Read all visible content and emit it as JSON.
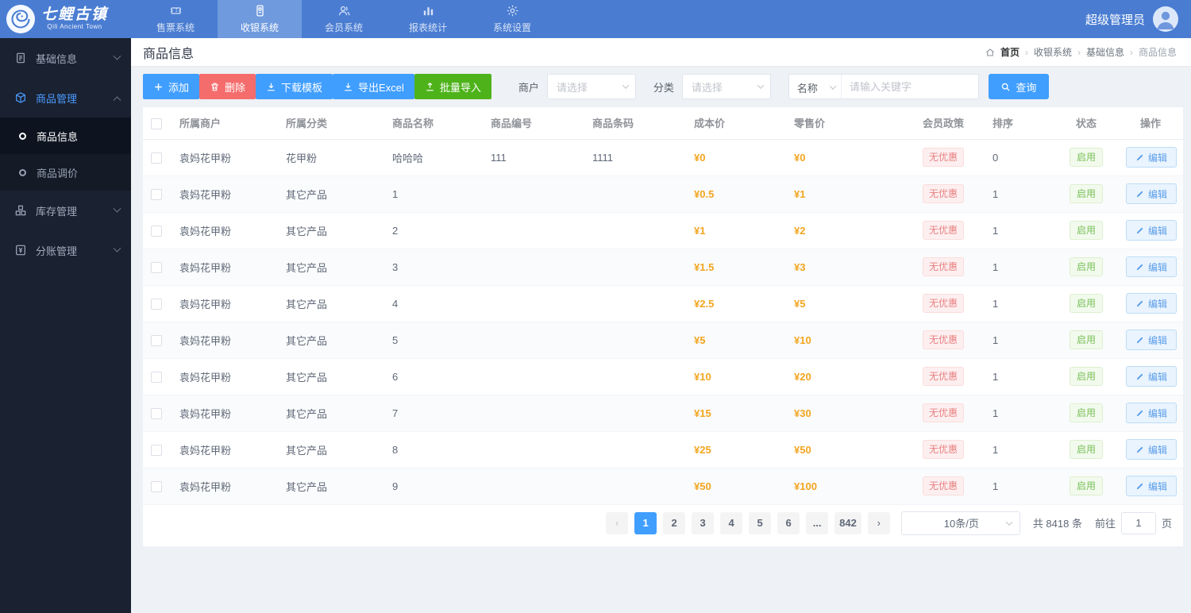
{
  "colors": {
    "topbar": "#4a7dd2",
    "accent": "#409eff",
    "danger": "#f56c6c",
    "success": "#4eb31b",
    "price": "#f2a51f"
  },
  "topbar": {
    "logo_title": "七鲤古镇",
    "logo_subtitle": "Qili Ancient Town",
    "nav": [
      {
        "label": "售票系统",
        "icon": "ticket-icon",
        "active": false
      },
      {
        "label": "收银系统",
        "icon": "pos-icon",
        "active": true
      },
      {
        "label": "会员系统",
        "icon": "members-icon",
        "active": false
      },
      {
        "label": "报表统计",
        "icon": "chart-icon",
        "active": false
      },
      {
        "label": "系统设置",
        "icon": "gear-icon",
        "active": false
      }
    ],
    "user": "超级管理员"
  },
  "sidebar": {
    "items": [
      {
        "label": "基础信息",
        "icon": "document-icon",
        "chevron": "down",
        "expanded": false,
        "children": []
      },
      {
        "label": "商品管理",
        "icon": "cube-icon",
        "chevron": "up",
        "expanded": true,
        "children": [
          {
            "label": "商品信息",
            "active": true
          },
          {
            "label": "商品调价",
            "active": false
          }
        ]
      },
      {
        "label": "库存管理",
        "icon": "inventory-icon",
        "chevron": "down",
        "expanded": false,
        "children": []
      },
      {
        "label": "分账管理",
        "icon": "ledger-icon",
        "chevron": "down",
        "expanded": false,
        "children": []
      }
    ]
  },
  "page": {
    "title": "商品信息",
    "breadcrumb": [
      "首页",
      "收银系统",
      "基础信息",
      "商品信息"
    ]
  },
  "toolbar": {
    "add_label": "添加",
    "delete_label": "删除",
    "download_template_label": "下载模板",
    "export_excel_label": "导出Excel",
    "batch_import_label": "批量导入",
    "merchant_label": "商户",
    "merchant_placeholder": "请选择",
    "category_label": "分类",
    "category_placeholder": "请选择",
    "name_field_label": "名称",
    "keyword_placeholder": "请输入关键字",
    "search_label": "查询"
  },
  "table": {
    "columns": [
      "所属商户",
      "所属分类",
      "商品名称",
      "商品编号",
      "商品条码",
      "成本价",
      "零售价",
      "会员政策",
      "排序",
      "状态",
      "操作"
    ],
    "edit_label": "编辑",
    "rows": [
      {
        "merchant": "袁妈花甲粉",
        "category": "花甲粉",
        "name": "哈哈哈",
        "code": "111",
        "barcode": "1111",
        "cost": "¥0",
        "price": "¥0",
        "policy": "无优惠",
        "sort": "0",
        "status": "启用"
      },
      {
        "merchant": "袁妈花甲粉",
        "category": "其它产品",
        "name": "1",
        "code": "",
        "barcode": "",
        "cost": "¥0.5",
        "price": "¥1",
        "policy": "无优惠",
        "sort": "1",
        "status": "启用"
      },
      {
        "merchant": "袁妈花甲粉",
        "category": "其它产品",
        "name": "2",
        "code": "",
        "barcode": "",
        "cost": "¥1",
        "price": "¥2",
        "policy": "无优惠",
        "sort": "1",
        "status": "启用"
      },
      {
        "merchant": "袁妈花甲粉",
        "category": "其它产品",
        "name": "3",
        "code": "",
        "barcode": "",
        "cost": "¥1.5",
        "price": "¥3",
        "policy": "无优惠",
        "sort": "1",
        "status": "启用"
      },
      {
        "merchant": "袁妈花甲粉",
        "category": "其它产品",
        "name": "4",
        "code": "",
        "barcode": "",
        "cost": "¥2.5",
        "price": "¥5",
        "policy": "无优惠",
        "sort": "1",
        "status": "启用"
      },
      {
        "merchant": "袁妈花甲粉",
        "category": "其它产品",
        "name": "5",
        "code": "",
        "barcode": "",
        "cost": "¥5",
        "price": "¥10",
        "policy": "无优惠",
        "sort": "1",
        "status": "启用"
      },
      {
        "merchant": "袁妈花甲粉",
        "category": "其它产品",
        "name": "6",
        "code": "",
        "barcode": "",
        "cost": "¥10",
        "price": "¥20",
        "policy": "无优惠",
        "sort": "1",
        "status": "启用"
      },
      {
        "merchant": "袁妈花甲粉",
        "category": "其它产品",
        "name": "7",
        "code": "",
        "barcode": "",
        "cost": "¥15",
        "price": "¥30",
        "policy": "无优惠",
        "sort": "1",
        "status": "启用"
      },
      {
        "merchant": "袁妈花甲粉",
        "category": "其它产品",
        "name": "8",
        "code": "",
        "barcode": "",
        "cost": "¥25",
        "price": "¥50",
        "policy": "无优惠",
        "sort": "1",
        "status": "启用"
      },
      {
        "merchant": "袁妈花甲粉",
        "category": "其它产品",
        "name": "9",
        "code": "",
        "barcode": "",
        "cost": "¥50",
        "price": "¥100",
        "policy": "无优惠",
        "sort": "1",
        "status": "启用"
      }
    ]
  },
  "pagination": {
    "pages": [
      "1",
      "2",
      "3",
      "4",
      "5",
      "6",
      "...",
      "842"
    ],
    "active_page": "1",
    "page_size": "10条/页",
    "total_text": "共 8418 条",
    "goto_prefix": "前往",
    "goto_value": "1",
    "goto_suffix": "页"
  }
}
